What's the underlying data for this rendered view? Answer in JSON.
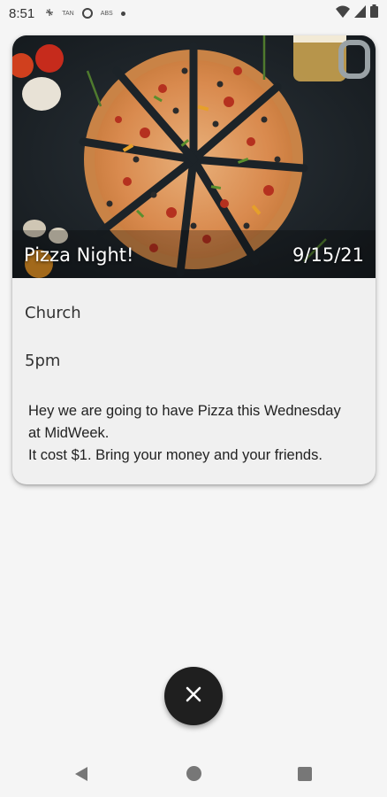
{
  "status_bar": {
    "time": "8:51",
    "icons": [
      "tan-icon",
      "tan-label-icon",
      "sync-circle-icon",
      "abs-icon",
      "dot-icon"
    ],
    "left_labels": [
      "TAN",
      "ABS"
    ],
    "right_icons": [
      "wifi-icon",
      "signal-icon",
      "battery-icon"
    ]
  },
  "event": {
    "title": "Pizza Night!",
    "date": "9/15/21",
    "location": "Church",
    "time": "5pm",
    "description_lines": [
      "Hey we are going to have Pizza this Wednesday",
      "at MidWeek.",
      "It cost $1. Bring your money and your friends."
    ]
  },
  "fab": {
    "icon": "close-icon"
  },
  "nav": {
    "back": "back-icon",
    "home": "home-icon",
    "recents": "recents-icon"
  },
  "colors": {
    "background": "#f5f5f5",
    "card": "#f0f0f0",
    "fab": "#1f1f1f"
  }
}
